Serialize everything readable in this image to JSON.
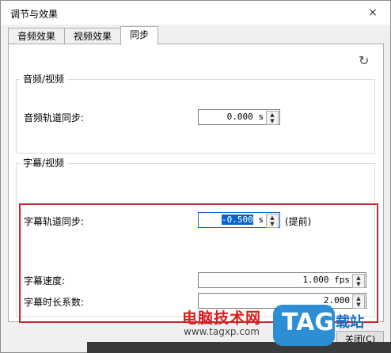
{
  "window": {
    "title": "调节与效果",
    "close_glyph": "×"
  },
  "tabs": [
    {
      "label": "音频效果"
    },
    {
      "label": "视频效果"
    },
    {
      "label": "同步"
    }
  ],
  "refresh_glyph": "↻",
  "audio_video": {
    "group_label": "音频/视频",
    "track_sync_label": "音频轨道同步:",
    "track_sync_value": "0.000 s"
  },
  "subtitle_video": {
    "group_label": "字幕/视频",
    "track_sync_label": "字幕轨道同步:",
    "track_sync_value_selected": "-0.500",
    "track_sync_unit": " s",
    "track_sync_note": "(提前)",
    "speed_label": "字幕速度:",
    "speed_value": "1.000 fps",
    "duration_label": "字幕时长系数:",
    "duration_value": "2.000"
  },
  "close_button_label": "关闭(C)",
  "watermark": {
    "site_name": "电脑技术网",
    "url": "www.tagxp.com",
    "tag": "TAG",
    "download": "载站"
  },
  "colors": {
    "highlight": "#c0272d",
    "selection": "#0a64cc",
    "tag_badge": "#2c8fd6"
  }
}
